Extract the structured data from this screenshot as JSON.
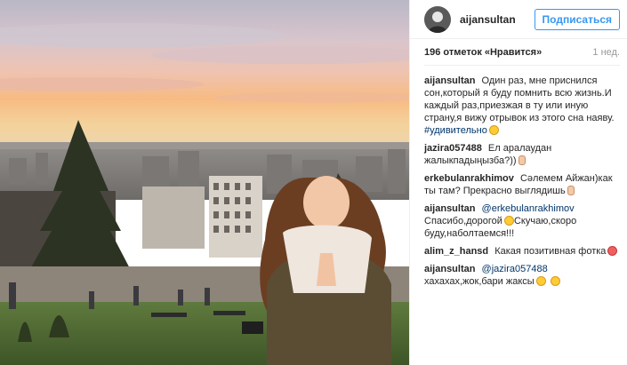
{
  "post": {
    "author": "aijansultan",
    "follow_label": "Подписаться",
    "likes_text": "196 отметок «Нравится»",
    "age": "1 нед."
  },
  "comments": [
    {
      "author": "aijansultan",
      "text": "Один раз, мне приснился сон,который я буду помнить всю жизнь.И каждый раз,приезжая в ту или иную страну,я вижу отрывок из этого сна наяву.",
      "hashtag": "#удивительно",
      "emoji": "grinning-face-icon"
    },
    {
      "author": "jazira057488",
      "text": "Ел аралаудан жалыкпадыңызба?))",
      "emoji": "victory-hand-icon"
    },
    {
      "author": "erkebulanrakhimov",
      "text": "Сәлемем Айжан)как ты там? Прекрасно выглядишь",
      "emoji": "victory-hand-icon"
    },
    {
      "author": "aijansultan",
      "mention": "@erkebulanrakhimov",
      "text": "Спасибо,дорогой",
      "emoji": "kissing-face-icon",
      "text2": "Скучаю,скоро буду,наболтаемся!!!"
    },
    {
      "author": "alim_z_hansd",
      "text": "Какая позитивная фотка",
      "emoji": "heart-eyes-face-icon"
    },
    {
      "author": "aijansultan",
      "mention": "@jazira057488",
      "text": "хахахах,жок,бари жаксы",
      "emoji": "tired-face-icon",
      "emoji2": "smiling-sweat-face-icon"
    }
  ],
  "colors": {
    "link": "#003569",
    "follow_blue": "#3897f0",
    "sky_top": "#c9c3cf",
    "sunset": "#f5b27a"
  }
}
